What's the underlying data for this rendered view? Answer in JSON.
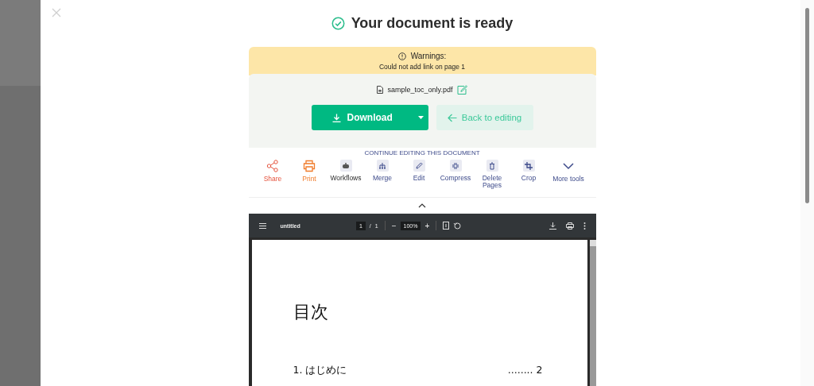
{
  "title": "Your document is ready",
  "warning": {
    "heading": "Warnings:",
    "message": "Could not add link on page 1"
  },
  "file": {
    "name": "sample_toc_only.pdf"
  },
  "download_button": "Download",
  "back_button": "Back to editing",
  "tools_heading": "CONTINUE EDITING THIS DOCUMENT",
  "tools": [
    {
      "kind": "share",
      "label": "Share"
    },
    {
      "kind": "print",
      "label": "Print"
    },
    {
      "kind": "workflows",
      "label": "Workflows"
    },
    {
      "kind": "merge",
      "label": "Merge"
    },
    {
      "kind": "edit",
      "label": "Edit"
    },
    {
      "kind": "compress",
      "label": "Compress"
    },
    {
      "kind": "delete",
      "label": "Delete Pages"
    },
    {
      "kind": "crop",
      "label": "Crop"
    },
    {
      "kind": "more",
      "label": "More tools"
    }
  ],
  "viewer": {
    "title": "untitled",
    "page": "1",
    "page_sep": "/",
    "page_total": "1",
    "zoom_out": "−",
    "zoom": "100%",
    "zoom_in": "+"
  },
  "pdf_page": {
    "heading": "目次",
    "entries": [
      {
        "label": "1. はじめに",
        "page": "........ 2"
      }
    ]
  }
}
